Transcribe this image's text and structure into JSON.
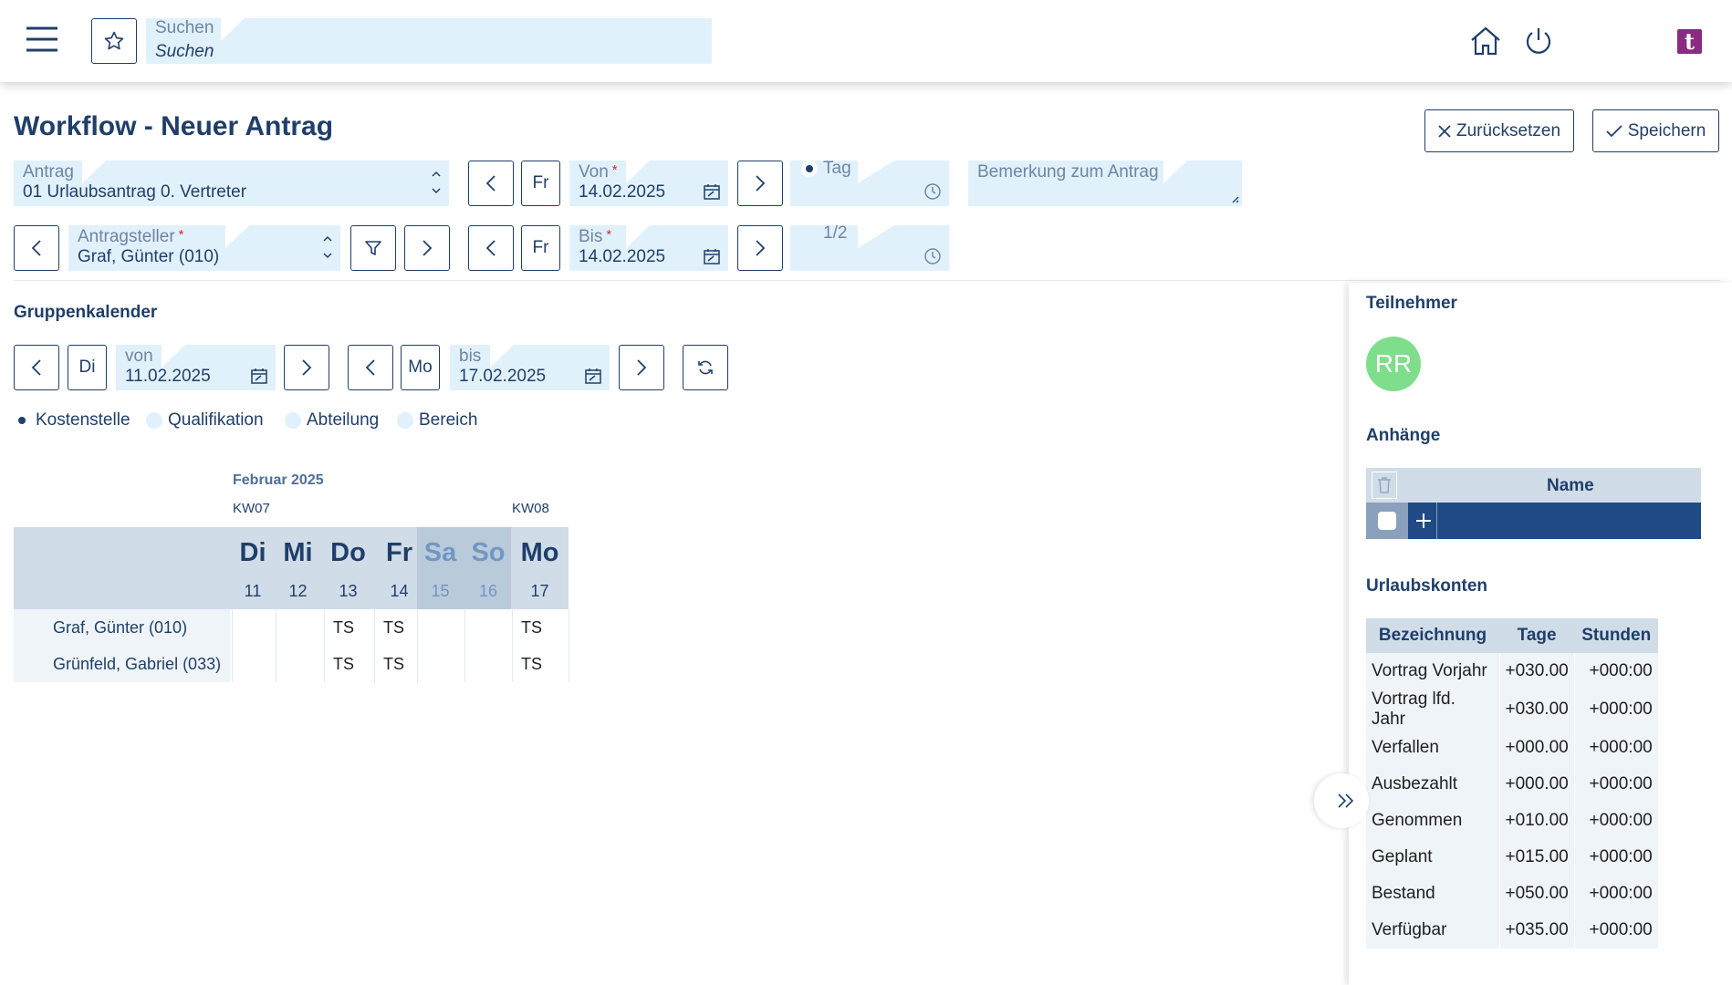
{
  "header": {
    "search_label": "Suchen",
    "search_placeholder": "Suchen",
    "logo_letter": "t"
  },
  "page_title": "Workflow - Neuer Antrag",
  "actions": {
    "reset_label": "Zurücksetzen",
    "save_label": "Speichern"
  },
  "form": {
    "antrag_label": "Antrag",
    "antrag_value": "01 Urlaubsantrag 0. Vertreter",
    "antragsteller_label": "Antragsteller",
    "antragsteller_value": "Graf, Günter (010)",
    "von_day": "Fr",
    "von_label": "Von",
    "von_value": "14.02.2025",
    "bis_day": "Fr",
    "bis_label": "Bis",
    "bis_value": "14.02.2025",
    "option_tag": "Tag",
    "option_half": "1/2",
    "bemerkung_label": "Bemerkung zum Antrag"
  },
  "gruppenkalender": {
    "title": "Gruppenkalender",
    "von_day": "Di",
    "von_label": "von",
    "von_value": "11.02.2025",
    "bis_day": "Mo",
    "bis_label": "bis",
    "bis_value": "17.02.2025",
    "filters": [
      "Kostenstelle",
      "Qualifikation",
      "Abteilung",
      "Bereich"
    ],
    "month": "Februar 2025",
    "weeks": [
      "KW07",
      "KW08"
    ],
    "days": [
      {
        "name": "Di",
        "num": "11",
        "weekend": false
      },
      {
        "name": "Mi",
        "num": "12",
        "weekend": false
      },
      {
        "name": "Do",
        "num": "13",
        "weekend": false
      },
      {
        "name": "Fr",
        "num": "14",
        "weekend": false
      },
      {
        "name": "Sa",
        "num": "15",
        "weekend": true
      },
      {
        "name": "So",
        "num": "16",
        "weekend": true
      },
      {
        "name": "Mo",
        "num": "17",
        "weekend": false
      }
    ],
    "rows": [
      {
        "name": "Graf, Günter (010)",
        "cells": [
          "",
          "",
          "TS",
          "TS",
          "",
          "",
          "TS"
        ]
      },
      {
        "name": "Grünfeld, Gabriel (033)",
        "cells": [
          "",
          "",
          "TS",
          "TS",
          "",
          "",
          "TS"
        ]
      }
    ]
  },
  "panel": {
    "teilnehmer_title": "Teilnehmer",
    "avatar_initials": "RR",
    "avatar_color": "#7ede8c",
    "anhaenge_title": "Anhänge",
    "anhaenge_col": "Name",
    "urlaub_title": "Urlaubskonten",
    "urlaub_headers": [
      "Bezeichnung",
      "Tage",
      "Stunden"
    ],
    "urlaub_rows": [
      [
        "Vortrag Vorjahr",
        "+030.00",
        "+000:00"
      ],
      [
        "Vortrag lfd. Jahr",
        "+030.00",
        "+000:00"
      ],
      [
        "Verfallen",
        "+000.00",
        "+000:00"
      ],
      [
        "Ausbezahlt",
        "+000.00",
        "+000:00"
      ],
      [
        "Genommen",
        "+010.00",
        "+000:00"
      ],
      [
        "Geplant",
        "+015.00",
        "+000:00"
      ],
      [
        "Bestand",
        "+050.00",
        "+000:00"
      ],
      [
        "Verfügbar",
        "+035.00",
        "+000:00"
      ]
    ]
  },
  "colors": {
    "primary": "#1f3f6a",
    "field_bg": "#e1f1fc",
    "header_bg": "#d0dce8",
    "accent_purple": "#8a2a82"
  }
}
